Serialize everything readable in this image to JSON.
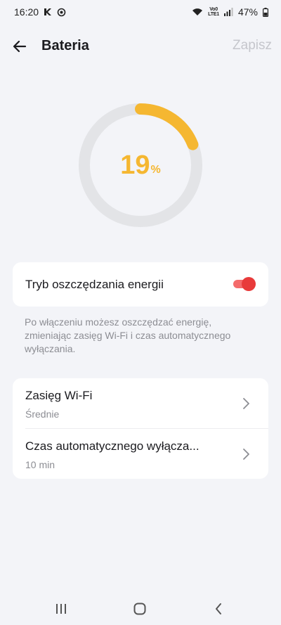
{
  "status_bar": {
    "time": "16:20",
    "battery_percent": "47%",
    "network_label_top": "Vo0",
    "network_label_bottom": "LTE1"
  },
  "header": {
    "title": "Bateria",
    "save_label": "Zapisz"
  },
  "gauge": {
    "value": "19",
    "unit": "%",
    "fraction": 0.19,
    "color": "#f5b731",
    "track_color": "#e3e4e7"
  },
  "power_saving": {
    "label": "Tryb oszczędzania energii",
    "enabled": true,
    "accent": "#e83a3a"
  },
  "description": "Po włączeniu możesz oszczędzać energię, zmieniając zasięg Wi-Fi i czas automatycznego wyłączania.",
  "settings": [
    {
      "title": "Zasięg Wi-Fi",
      "value": "Średnie"
    },
    {
      "title": "Czas automatycznego wyłącza...",
      "value": "10 min"
    }
  ],
  "nav_icons": [
    "recents-icon",
    "home-icon",
    "back-icon"
  ]
}
